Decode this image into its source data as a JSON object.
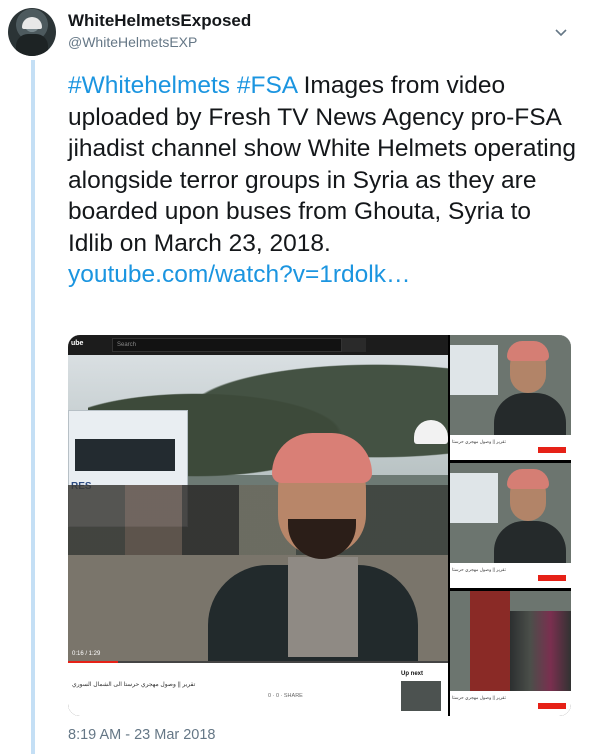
{
  "author": {
    "name": "WhiteHelmetsExposed",
    "handle": "@WhiteHelmetsEXP"
  },
  "tweet": {
    "hashtag1": "#Whitehelmets",
    "hashtag2": "#FSA",
    "body": " Images from video uploaded by Fresh TV News Agency pro-FSA jihadist channel show White Helmets operating alongside terror groups in Syria as they are boarded upon buses from Ghouta, Syria to Idlib on March 23, 2018.",
    "link": "youtube.com/watch?v=1rdolk…"
  },
  "media": {
    "yt_logo": "ube",
    "search_placeholder": "Search",
    "bus_sign": "RES",
    "timecode": "0:16 / 1:29",
    "video_title": "تقرير || وصول مهجري حرستا الى الشمال السوري",
    "actions": "0  ·  0  ·  SHARE",
    "up_next": "Up next",
    "side_meta": "تقرير || وصول مهجري حرستا"
  },
  "timestamp": "8:19 AM - 23 Mar 2018",
  "colors": {
    "link": "#1b95e0",
    "text": "#14171a",
    "muted": "#657786",
    "thread": "#c4dff5"
  }
}
